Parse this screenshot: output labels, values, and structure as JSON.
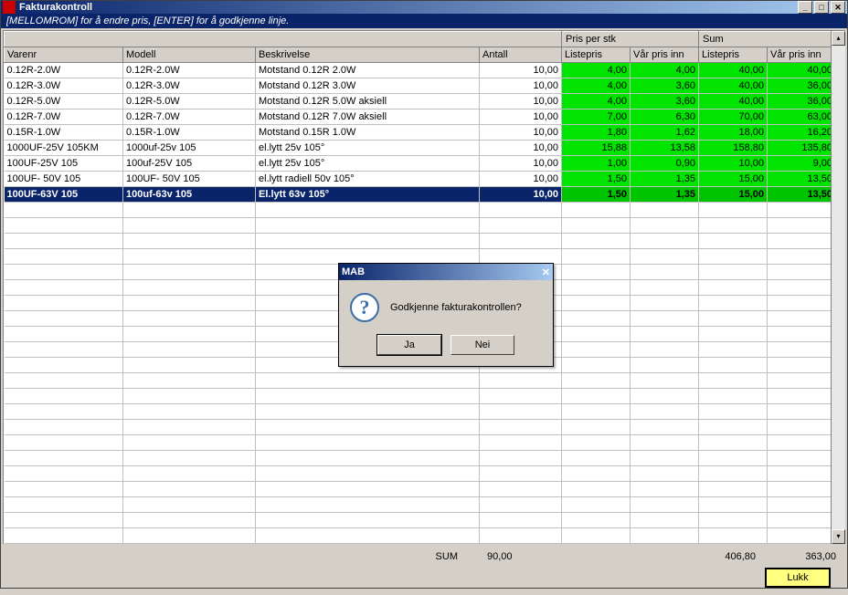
{
  "window": {
    "title": "Fakturakontroll",
    "hint": "[MELLOMROM] for å endre pris, [ENTER] for å godkjenne linje."
  },
  "header": {
    "group_pris": "Pris per stk",
    "group_sum": "Sum",
    "varenr": "Varenr",
    "modell": "Modell",
    "beskrivelse": "Beskrivelse",
    "antall": "Antall",
    "listepris": "Listepris",
    "varpris": "Vår pris inn"
  },
  "rows": [
    {
      "varenr": "0.12R-2.0W",
      "modell": "0.12R-2.0W",
      "besk": "Motstand 0.12R 2.0W",
      "antall": "10,00",
      "lp1": "4,00",
      "vp1": "4,00",
      "lp2": "40,00",
      "vp2": "40,00",
      "sel": false
    },
    {
      "varenr": "0.12R-3.0W",
      "modell": "0.12R-3.0W",
      "besk": "Motstand 0.12R 3.0W",
      "antall": "10,00",
      "lp1": "4,00",
      "vp1": "3,60",
      "lp2": "40,00",
      "vp2": "36,00",
      "sel": false
    },
    {
      "varenr": "0.12R-5.0W",
      "modell": "0.12R-5.0W",
      "besk": "Motstand 0.12R 5.0W aksiell",
      "antall": "10,00",
      "lp1": "4,00",
      "vp1": "3,60",
      "lp2": "40,00",
      "vp2": "36,00",
      "sel": false
    },
    {
      "varenr": "0.12R-7.0W",
      "modell": "0.12R-7.0W",
      "besk": "Motstand 0.12R 7.0W aksiell",
      "antall": "10,00",
      "lp1": "7,00",
      "vp1": "6,30",
      "lp2": "70,00",
      "vp2": "63,00",
      "sel": false
    },
    {
      "varenr": "0.15R-1.0W",
      "modell": "0.15R-1.0W",
      "besk": "Motstand 0.15R 1.0W",
      "antall": "10,00",
      "lp1": "1,80",
      "vp1": "1,62",
      "lp2": "18,00",
      "vp2": "16,20",
      "sel": false
    },
    {
      "varenr": "1000UF-25V 105KM",
      "modell": "1000uf-25v 105",
      "besk": "el.lytt 25v 105°",
      "antall": "10,00",
      "lp1": "15,88",
      "vp1": "13,58",
      "lp2": "158,80",
      "vp2": "135,80",
      "sel": false
    },
    {
      "varenr": "100UF-25V 105",
      "modell": "100uf-25V 105",
      "besk": "el.lytt 25v 105°",
      "antall": "10,00",
      "lp1": "1,00",
      "vp1": "0,90",
      "lp2": "10,00",
      "vp2": "9,00",
      "sel": false
    },
    {
      "varenr": "100UF- 50V 105",
      "modell": "100UF- 50V 105",
      "besk": "el.lytt radiell 50v 105°",
      "antall": "10,00",
      "lp1": "1,50",
      "vp1": "1,35",
      "lp2": "15,00",
      "vp2": "13,50",
      "sel": false
    },
    {
      "varenr": "100UF-63V 105",
      "modell": "100uf-63v 105",
      "besk": "El.lytt 63v 105°",
      "antall": "10,00",
      "lp1": "1,50",
      "vp1": "1,35",
      "lp2": "15,00",
      "vp2": "13,50",
      "sel": true
    }
  ],
  "empty_rows": 22,
  "footer": {
    "sum_label": "SUM",
    "sum_antall": "90,00",
    "sum_lp": "406,80",
    "sum_vp": "363,00"
  },
  "buttons": {
    "lukk": "Lukk"
  },
  "dialog": {
    "title": "MAB",
    "message": "Godkjenne fakturakontrollen?",
    "yes": "Ja",
    "no": "Nei"
  }
}
